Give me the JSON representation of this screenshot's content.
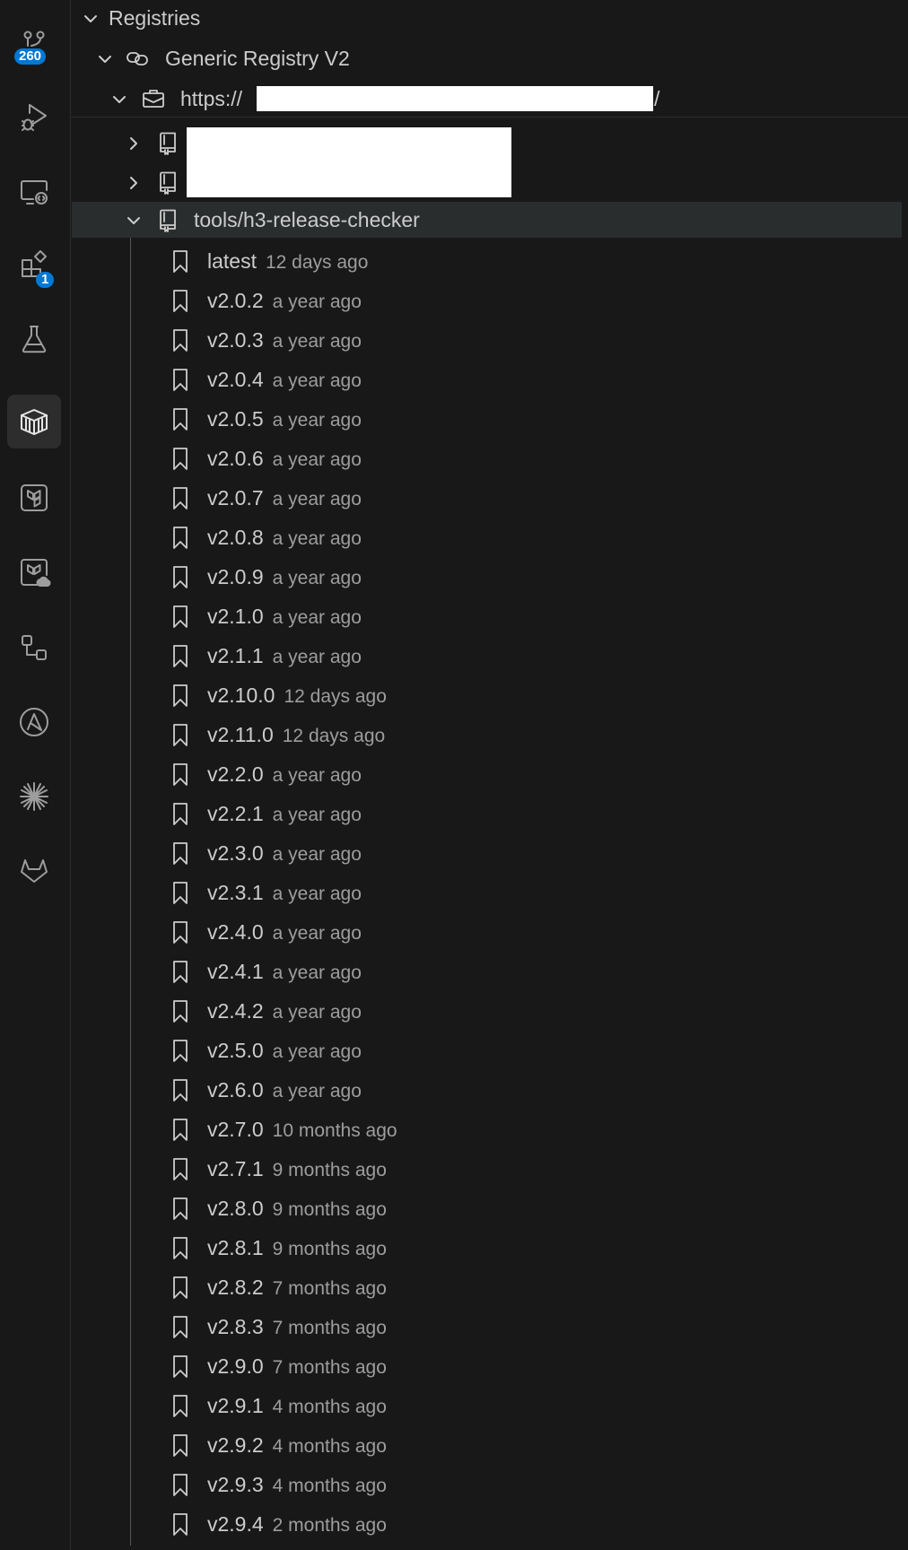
{
  "activity_bar": {
    "items": [
      {
        "name": "source-control",
        "icon": "source-control-icon",
        "badge": "260"
      },
      {
        "name": "run-debug",
        "icon": "run-debug-icon"
      },
      {
        "name": "remote-explorer",
        "icon": "remote-explorer-icon"
      },
      {
        "name": "extensions",
        "icon": "extensions-icon",
        "badge": "1"
      },
      {
        "name": "testing",
        "icon": "flask-icon"
      },
      {
        "name": "containers",
        "icon": "container-icon",
        "active": true
      },
      {
        "name": "terraform",
        "icon": "terraform-icon"
      },
      {
        "name": "terraform-cloud",
        "icon": "terraform-cloud-icon"
      },
      {
        "name": "workflow",
        "icon": "workflow-icon"
      },
      {
        "name": "ansible",
        "icon": "ansible-icon"
      },
      {
        "name": "sparkle",
        "icon": "sparkle-icon"
      },
      {
        "name": "gitlab",
        "icon": "gitlab-icon"
      }
    ]
  },
  "tree": {
    "section_label": "Registries",
    "registry_label": "Generic Registry V2",
    "url_prefix": "https://",
    "url_suffix": "/",
    "repo_label": "tools/h3-release-checker",
    "tags": [
      {
        "label": "latest",
        "desc": "12 days ago"
      },
      {
        "label": "v2.0.2",
        "desc": "a year ago"
      },
      {
        "label": "v2.0.3",
        "desc": "a year ago"
      },
      {
        "label": "v2.0.4",
        "desc": "a year ago"
      },
      {
        "label": "v2.0.5",
        "desc": "a year ago"
      },
      {
        "label": "v2.0.6",
        "desc": "a year ago"
      },
      {
        "label": "v2.0.7",
        "desc": "a year ago"
      },
      {
        "label": "v2.0.8",
        "desc": "a year ago"
      },
      {
        "label": "v2.0.9",
        "desc": "a year ago"
      },
      {
        "label": "v2.1.0",
        "desc": "a year ago"
      },
      {
        "label": "v2.1.1",
        "desc": "a year ago"
      },
      {
        "label": "v2.10.0",
        "desc": "12 days ago"
      },
      {
        "label": "v2.11.0",
        "desc": "12 days ago"
      },
      {
        "label": "v2.2.0",
        "desc": "a year ago"
      },
      {
        "label": "v2.2.1",
        "desc": "a year ago"
      },
      {
        "label": "v2.3.0",
        "desc": "a year ago"
      },
      {
        "label": "v2.3.1",
        "desc": "a year ago"
      },
      {
        "label": "v2.4.0",
        "desc": "a year ago"
      },
      {
        "label": "v2.4.1",
        "desc": "a year ago"
      },
      {
        "label": "v2.4.2",
        "desc": "a year ago"
      },
      {
        "label": "v2.5.0",
        "desc": "a year ago"
      },
      {
        "label": "v2.6.0",
        "desc": "a year ago"
      },
      {
        "label": "v2.7.0",
        "desc": "10 months ago"
      },
      {
        "label": "v2.7.1",
        "desc": "9 months ago"
      },
      {
        "label": "v2.8.0",
        "desc": "9 months ago"
      },
      {
        "label": "v2.8.1",
        "desc": "9 months ago"
      },
      {
        "label": "v2.8.2",
        "desc": "7 months ago"
      },
      {
        "label": "v2.8.3",
        "desc": "7 months ago"
      },
      {
        "label": "v2.9.0",
        "desc": "7 months ago"
      },
      {
        "label": "v2.9.1",
        "desc": "4 months ago"
      },
      {
        "label": "v2.9.2",
        "desc": "4 months ago"
      },
      {
        "label": "v2.9.3",
        "desc": "4 months ago"
      },
      {
        "label": "v2.9.4",
        "desc": "2 months ago"
      }
    ]
  }
}
